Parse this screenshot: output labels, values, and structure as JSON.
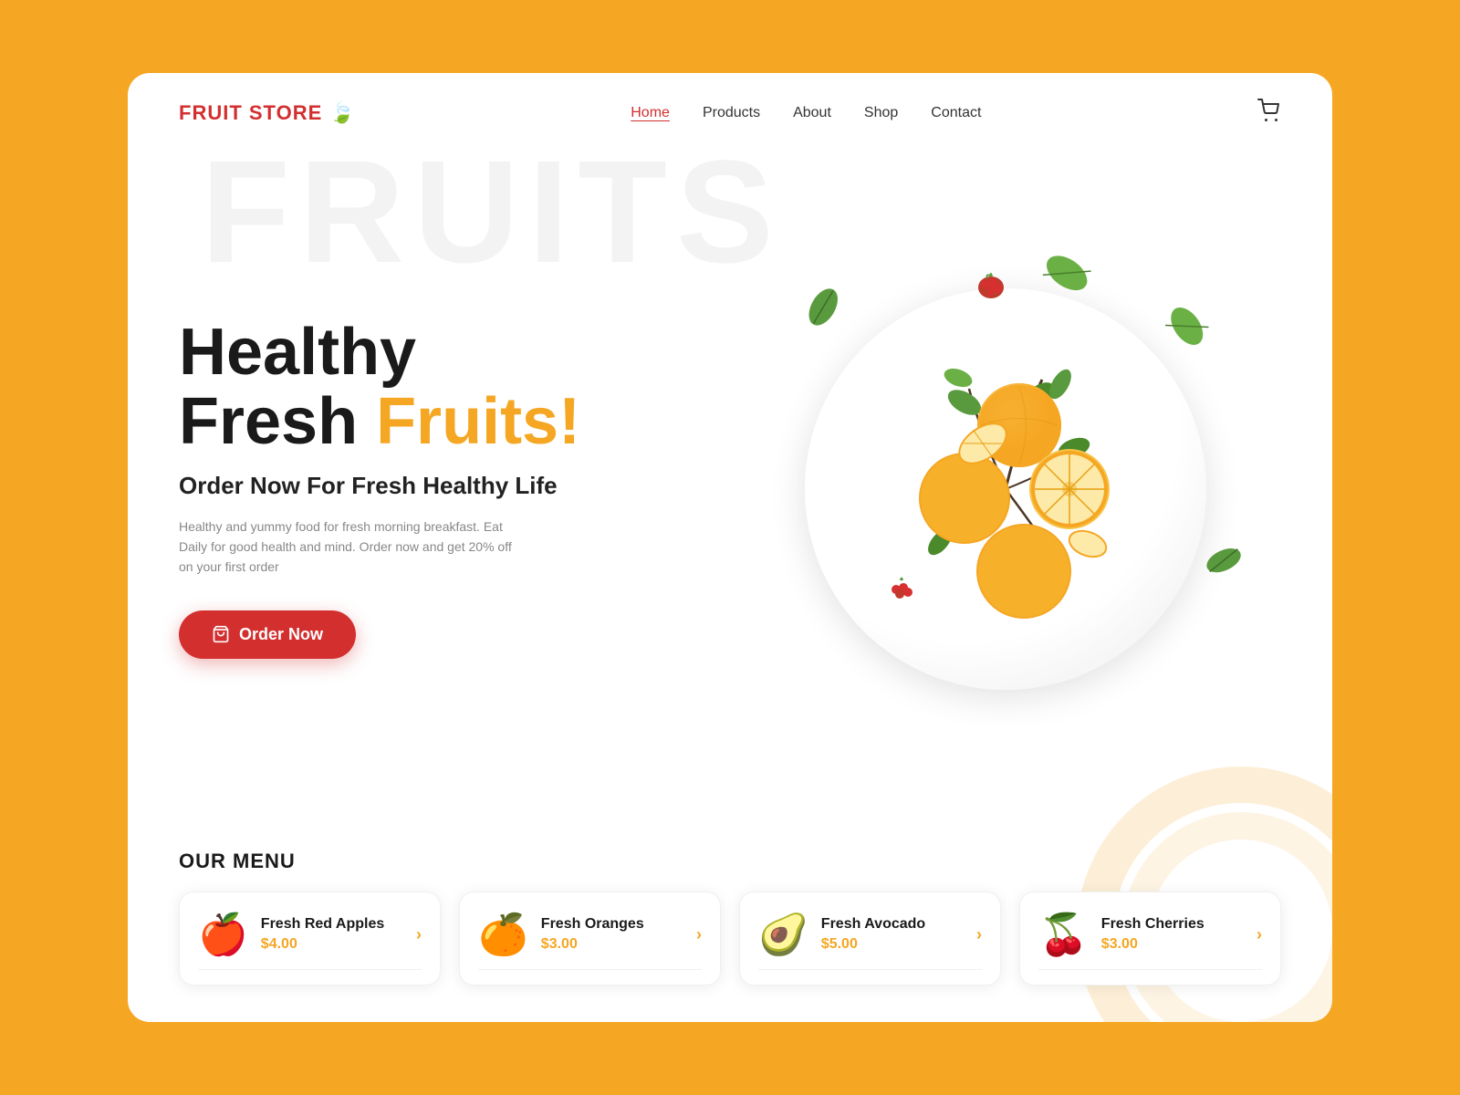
{
  "brand": {
    "name": "FRUIT STORE",
    "leaf_icon": "🍃"
  },
  "nav": {
    "links": [
      {
        "label": "Home",
        "active": true
      },
      {
        "label": "Products",
        "active": false
      },
      {
        "label": "About",
        "active": false
      },
      {
        "label": "Shop",
        "active": false
      },
      {
        "label": "Contact",
        "active": false
      }
    ],
    "cart_label": "Cart"
  },
  "hero": {
    "title_line1": "Healthy",
    "title_line2": "Fresh ",
    "title_highlight": "Fruits!",
    "subtitle": "Order Now For Fresh Healthy Life",
    "description": "Healthy and yummy food for fresh morning breakfast. Eat Daily for good health and mind. Order now and get 20% off on your first order",
    "cta_label": "Order Now",
    "watermark": "FRUITS"
  },
  "menu": {
    "section_title": "OUR MENU",
    "items": [
      {
        "name": "Fresh Red Apples",
        "price": "$4.00",
        "emoji": "🍎"
      },
      {
        "name": "Fresh Oranges",
        "price": "$3.00",
        "emoji": "🍊"
      },
      {
        "name": "Fresh Avocado",
        "price": "$5.00",
        "emoji": "🥑"
      },
      {
        "name": "Fresh Cherries",
        "price": "$3.00",
        "emoji": "🍒"
      }
    ]
  },
  "colors": {
    "primary": "#D32F2F",
    "accent": "#F5A623",
    "bg": "#F5A623",
    "card_bg": "#ffffff"
  }
}
